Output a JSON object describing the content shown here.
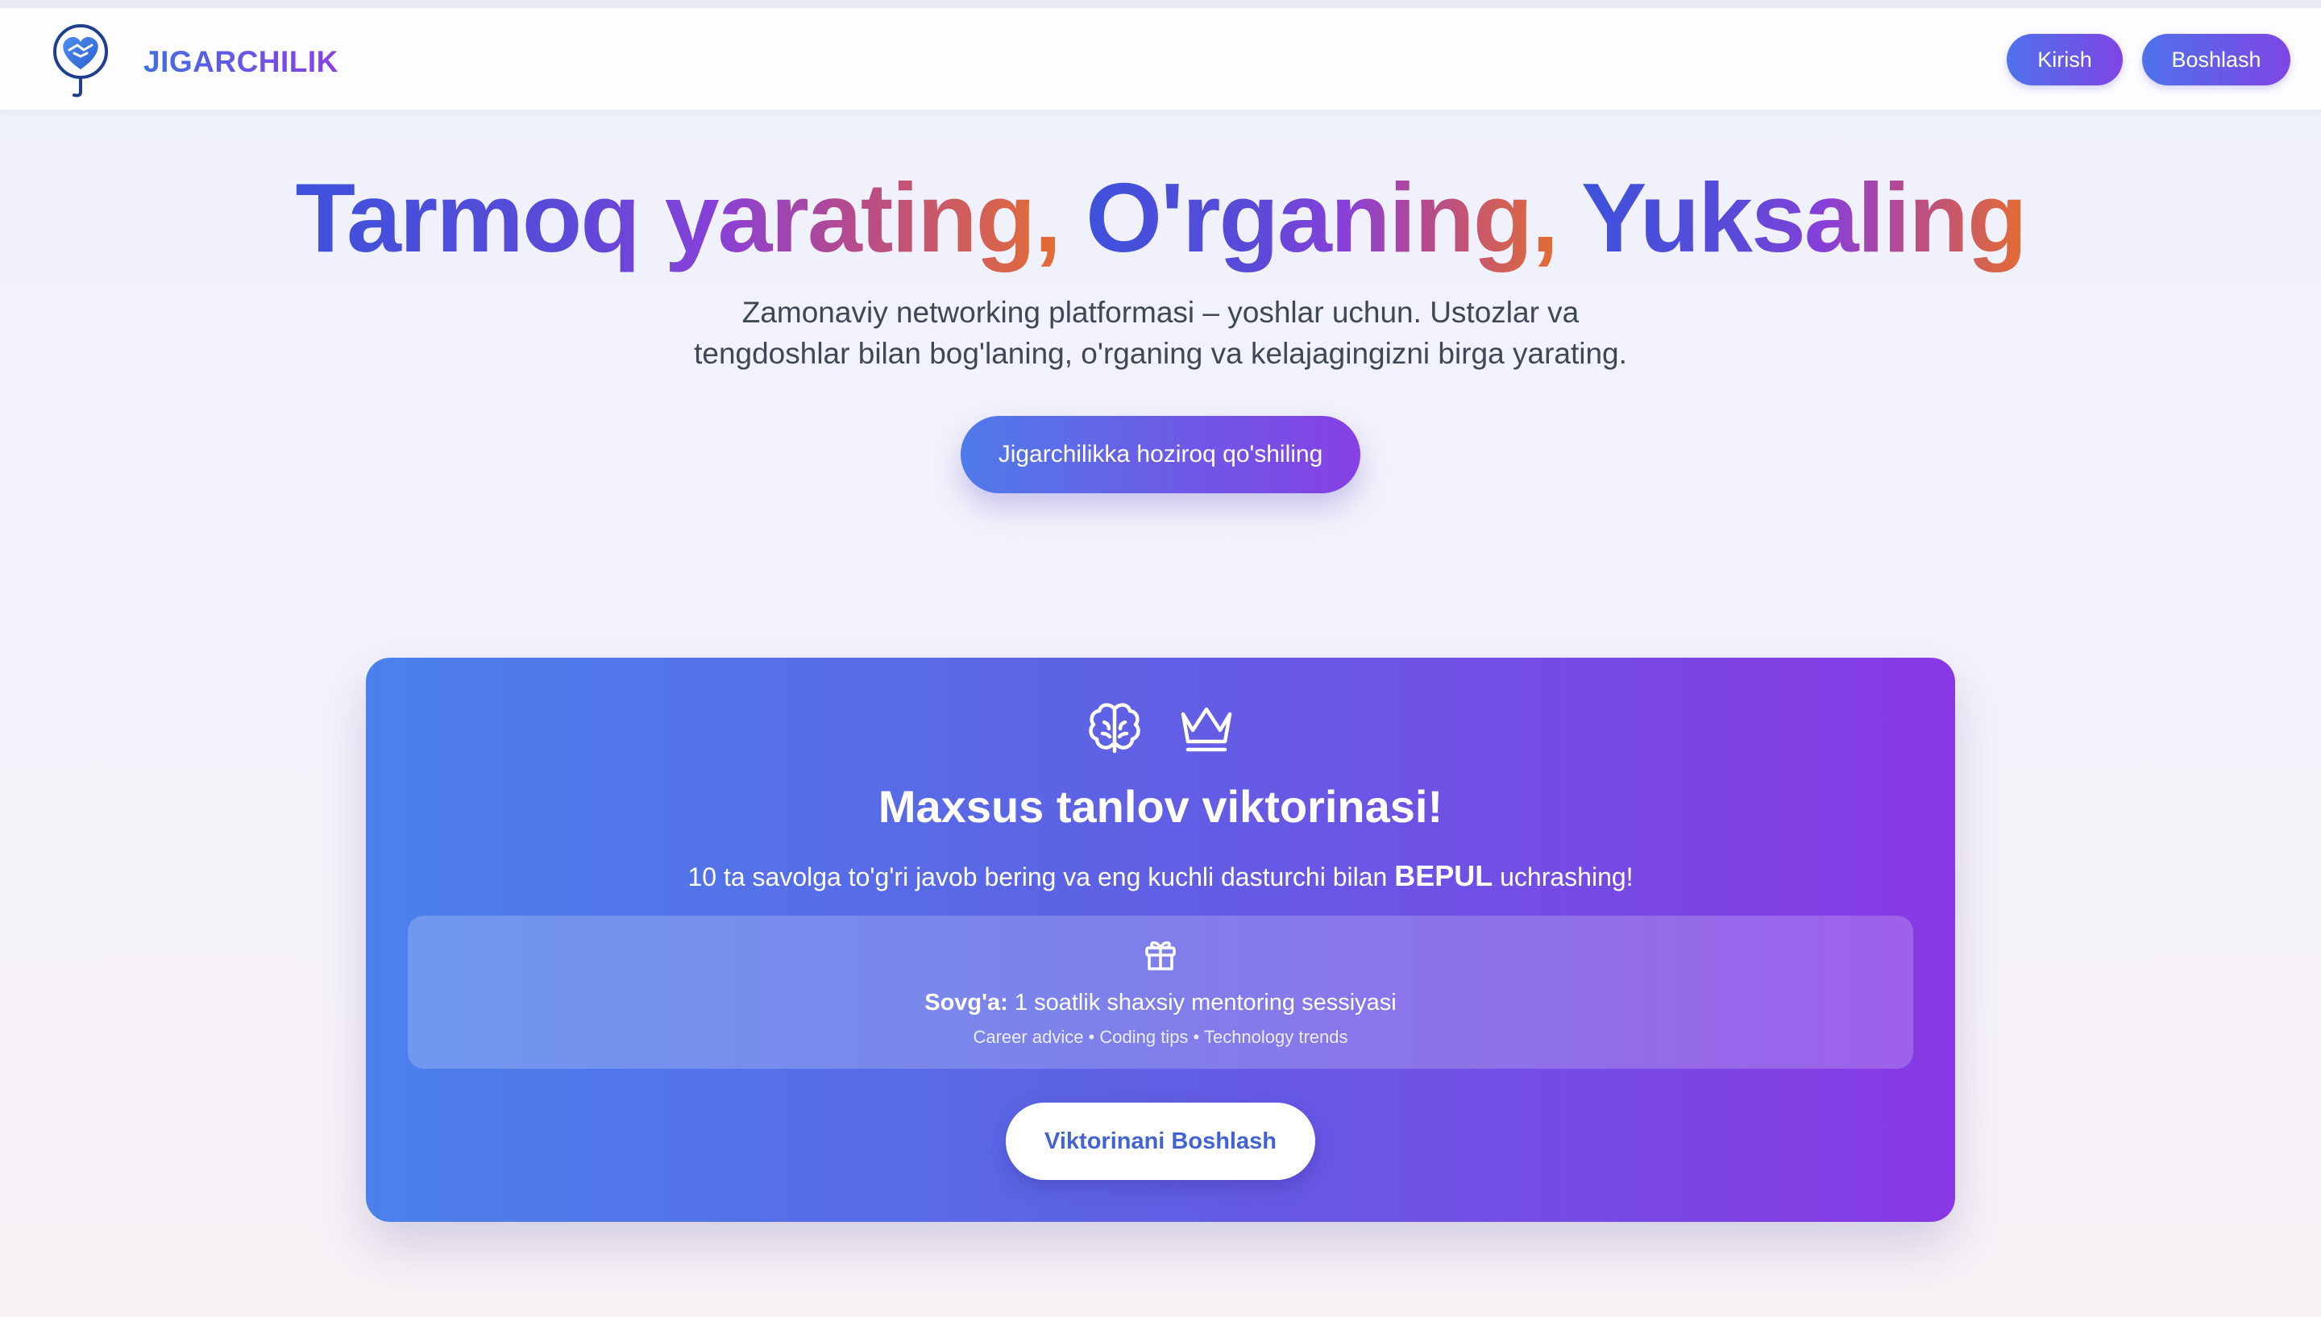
{
  "navbar": {
    "brand": "JIGARCHILIK",
    "login_label": "Kirish",
    "start_label": "Boshlash"
  },
  "hero": {
    "title_part1": "Tarmoq yarating,",
    "title_part2": "O'rganing,",
    "title_part3": "Yuksaling",
    "subtitle": "Zamonaviy networking platformasi – yoshlar uchun. Ustozlar va tengdoshlar bilan bog'laning, o'rganing va kelajagingizni birga yarating.",
    "cta_label": "Jigarchilikka hoziroq qo'shiling"
  },
  "quiz": {
    "icons": [
      "brain-icon",
      "crown-icon"
    ],
    "title": "Maxsus tanlov viktorinasi!",
    "desc_before": "10 ta savolga to'g'ri javob bering va eng kuchli dasturchi bilan",
    "desc_bold": "BEPUL",
    "desc_after": "uchrashing!",
    "gift": {
      "icon": "gift-icon",
      "label": "Sovg'a:",
      "text": "1 soatlik shaxsiy mentoring sessiyasi",
      "tags": "Career advice • Coding tips • Technology trends"
    },
    "button_label": "Viktorinani Boshlash"
  },
  "colors": {
    "accent_start": "#4b81ec",
    "accent_end": "#8838e4",
    "title_warm": "#e46d32"
  }
}
